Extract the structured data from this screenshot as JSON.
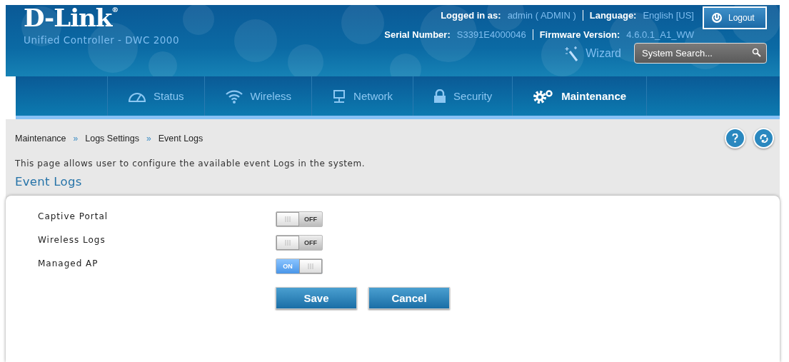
{
  "header": {
    "logo": "D-Link",
    "logo_mark": "®",
    "product": "Unified Controller - DWC 2000",
    "info_rows": [
      [
        {
          "label": "Logged in as:",
          "value": "admin ( ADMIN )"
        },
        {
          "label": "Language:",
          "value": "English [US]"
        }
      ],
      [
        {
          "label": "Serial Number:",
          "value": "S3391E4000046"
        },
        {
          "label": "Firmware Version:",
          "value": "4.6.0.1_A1_WW"
        }
      ]
    ],
    "logout": "Logout",
    "wizard": "Wizard",
    "search": {
      "placeholder": "System Search..."
    }
  },
  "nav": [
    {
      "label": "Status",
      "kind": "gauge",
      "selected": false
    },
    {
      "label": "Wireless",
      "kind": "wifi",
      "selected": false
    },
    {
      "label": "Network",
      "kind": "monitor",
      "selected": false
    },
    {
      "label": "Security",
      "kind": "lock",
      "selected": false
    },
    {
      "label": "Maintenance",
      "kind": "gears",
      "selected": true
    }
  ],
  "breadcrumb": [
    "Maintenance",
    "Logs Settings",
    "Event Logs"
  ],
  "breadcrumb_separator": "»",
  "description": "This page allows user to configure the available event Logs in the system.",
  "section_title": "Event Logs",
  "settings": [
    {
      "label": "Captive Portal",
      "on": false,
      "switch_text": "OFF"
    },
    {
      "label": "Wireless Logs",
      "on": false,
      "switch_text": "OFF"
    },
    {
      "label": "Managed AP",
      "on": true,
      "switch_text": "ON"
    }
  ],
  "buttons": [
    "Save",
    "Cancel"
  ]
}
